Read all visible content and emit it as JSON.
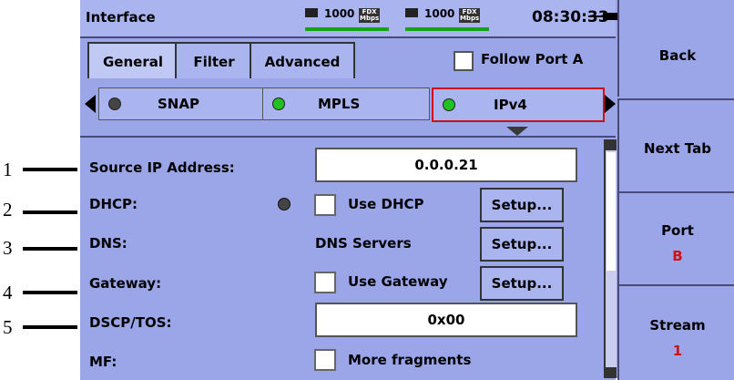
{
  "callouts": [
    "1",
    "2",
    "3",
    "4",
    "5"
  ],
  "header": {
    "title": "Interface",
    "link1_speed": "1000",
    "link1_duplex": "FDX",
    "link1_unit": "Mbps",
    "link2_speed": "1000",
    "link2_duplex": "FDX",
    "link2_unit": "Mbps",
    "time": "08:30:33",
    "power_icon": "plug-icon"
  },
  "tabs": [
    {
      "label": "General",
      "active": true
    },
    {
      "label": "Filter",
      "active": false
    },
    {
      "label": "Advanced",
      "active": false
    }
  ],
  "follow_port": {
    "label": "Follow Port A",
    "checked": false
  },
  "protocols": [
    {
      "label": "SNAP",
      "status": "off"
    },
    {
      "label": "MPLS",
      "status": "on"
    },
    {
      "label": "IPv4",
      "status": "on",
      "selected": true
    }
  ],
  "fields": {
    "source_ip": {
      "label": "Source IP Address:",
      "value": "0.0.0.21"
    },
    "dhcp": {
      "label": "DHCP:",
      "checkbox_label": "Use DHCP",
      "checked": false,
      "button": "Setup..."
    },
    "dns": {
      "label": "DNS:",
      "value": "DNS Servers",
      "button": "Setup..."
    },
    "gateway": {
      "label": "Gateway:",
      "checkbox_label": "Use Gateway",
      "checked": false,
      "button": "Setup..."
    },
    "dscp": {
      "label": "DSCP/TOS:",
      "value": "0x00"
    },
    "mf": {
      "label": "MF:",
      "checkbox_label": "More fragments",
      "checked": false
    }
  },
  "sidebar": {
    "back": "Back",
    "next_tab": "Next Tab",
    "port": {
      "label": "Port",
      "value": "B"
    },
    "stream": {
      "label": "Stream",
      "value": "1"
    }
  },
  "colors": {
    "background": "#9aa6e8",
    "led_on": "#22c022",
    "led_off": "#444444",
    "highlight": "#d01010",
    "link_bar": "#16a316"
  }
}
